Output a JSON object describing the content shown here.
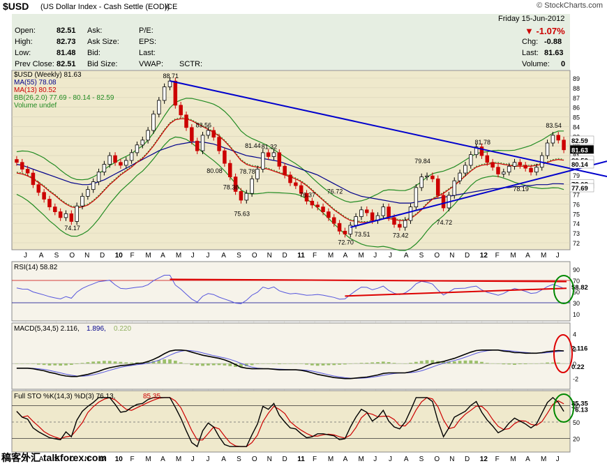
{
  "header": {
    "symbol": "$USD",
    "name": "(US Dollar Index - Cash Settle (EOD))",
    "exchange": "ICE",
    "brand": "© StockCharts.com"
  },
  "quote": {
    "open_label": "Open:",
    "open": "82.51",
    "high_label": "High:",
    "high": "82.73",
    "low_label": "Low:",
    "low": "81.48",
    "prev_label": "Prev Close:",
    "prev": "82.51",
    "ask_label": "Ask:",
    "asksize_label": "Ask Size:",
    "bid_label": "Bid:",
    "bidsize_label": "Bid Size:",
    "pe_label": "P/E:",
    "eps_label": "EPS:",
    "last_label": "Last:",
    "vwap_label": "VWAP:",
    "sctr_label": "SCTR:",
    "date": "Friday  15-Jun-2012",
    "change_pct": "▼ -1.07%",
    "chg_label": "Chg:",
    "chg": "-0.88",
    "last2_label": "Last:",
    "last2": "81.63",
    "volume_label": "Volume:",
    "volume": "0"
  },
  "legend": {
    "main": "$USD (Weekly) 81.63",
    "ma55": "MA(55) 78.08",
    "ma13": "MA(13) 80.52",
    "bb": "BB(26,2.0) 77.69 - 80.14 - 82.59",
    "vol": "Volume undef"
  },
  "panels": {
    "rsi_label": "RSI(14) 58.82",
    "macd_label_a": "MACD(5,34,5) 2.116,",
    "macd_label_b": "1.896,",
    "macd_label_c": "0.220",
    "sto_label_a": "Full STO %K(14,3) %D(3) 76.13,",
    "sto_label_b": "85.35"
  },
  "watermark": "稿客外汇 talkforex.com",
  "colors": {
    "trend": "#0000cc",
    "bb": "#228b22",
    "ma13": "#cc0000",
    "ma55": "#00008b",
    "up": "#000000",
    "down": "#cc0000",
    "panelbg": "#efe9cc",
    "quotebg": "#e6eee2"
  },
  "chart_data": {
    "type": "candlestick",
    "interval": "weekly",
    "ylim": [
      72,
      89
    ],
    "price_ticks": [
      72,
      73,
      74,
      75,
      76,
      77,
      78,
      79,
      80,
      81,
      82,
      83,
      84,
      85,
      86,
      87,
      88,
      89
    ],
    "x_labels": [
      "J",
      "A",
      "S",
      "O",
      "N",
      "D",
      "10",
      "F",
      "M",
      "A",
      "M",
      "J",
      "J",
      "A",
      "S",
      "O",
      "N",
      "D",
      "11",
      "F",
      "M",
      "A",
      "M",
      "J",
      "J",
      "A",
      "S",
      "O",
      "N",
      "D",
      "12",
      "F",
      "M",
      "A",
      "M",
      "J"
    ],
    "annotations": [
      {
        "label": "88.71",
        "value": 88.71
      },
      {
        "label": "83.56",
        "value": 83.56
      },
      {
        "label": "80.08",
        "value": 80.08
      },
      {
        "label": "81.44",
        "value": 81.44
      },
      {
        "label": "81.32",
        "value": 81.32
      },
      {
        "label": "78.36",
        "value": 78.36
      },
      {
        "label": "78.78",
        "value": 78.78
      },
      {
        "label": "75.63",
        "value": 75.63
      },
      {
        "label": "74.17",
        "value": 74.17
      },
      {
        "label": "76.37",
        "value": 76.37
      },
      {
        "label": "76.72",
        "value": 76.72
      },
      {
        "label": "72.70",
        "value": 72.7
      },
      {
        "label": "73.51",
        "value": 73.51
      },
      {
        "label": "73.42",
        "value": 73.42
      },
      {
        "label": "79.84",
        "value": 79.84
      },
      {
        "label": "74.72",
        "value": 74.72
      },
      {
        "label": "81.78",
        "value": 81.78
      },
      {
        "label": "78.19",
        "value": 78.19
      },
      {
        "label": "83.54",
        "value": 83.54
      }
    ],
    "right_labels": [
      {
        "label": "82.59",
        "value": 82.59
      },
      {
        "label": "81.63",
        "value": 81.63
      },
      {
        "label": "80.52",
        "value": 80.52
      },
      {
        "label": "80.14",
        "value": 80.14
      },
      {
        "label": "78.08",
        "value": 78.08
      },
      {
        "label": "77.69",
        "value": 77.69
      }
    ],
    "close_path": [
      80.3,
      79.6,
      79.2,
      78.0,
      77.2,
      76.5,
      75.7,
      75.2,
      74.6,
      75.0,
      74.2,
      75.8,
      76.8,
      77.5,
      78.3,
      79.3,
      80.1,
      81.0,
      80.3,
      80.0,
      80.5,
      81.3,
      82.1,
      82.6,
      83.6,
      85.3,
      86.7,
      88.1,
      88.7,
      86.2,
      85.2,
      83.9,
      82.5,
      81.5,
      83.1,
      83.6,
      82.9,
      81.5,
      80.2,
      78.8,
      77.3,
      76.4,
      77.1,
      78.6,
      79.6,
      81.3,
      80.9,
      81.3,
      79.9,
      79.0,
      78.2,
      77.9,
      77.1,
      76.3,
      75.9,
      75.7,
      75.2,
      74.6,
      74.0,
      73.2,
      72.9,
      73.8,
      74.7,
      75.4,
      75.1,
      74.3,
      74.8,
      75.7,
      74.6,
      73.9,
      73.6,
      74.3,
      75.7,
      77.7,
      78.8,
      78.9,
      78.6,
      76.9,
      75.6,
      76.9,
      78.4,
      79.2,
      80.0,
      81.1,
      81.9,
      81.0,
      80.3,
      79.8,
      79.1,
      79.3,
      79.9,
      80.3,
      80.0,
      79.7,
      79.3,
      79.8,
      81.0,
      82.3,
      83.1,
      82.6,
      81.6
    ],
    "ma13": [
      79.2,
      79.1,
      78.9,
      78.6,
      78.2,
      77.8,
      77.3,
      76.9,
      76.4,
      76.0,
      75.7,
      75.6,
      75.7,
      75.9,
      76.3,
      76.8,
      77.4,
      78.0,
      78.5,
      79.0,
      79.4,
      79.8,
      80.3,
      80.7,
      81.3,
      82.0,
      82.8,
      83.6,
      84.3,
      84.7,
      84.8,
      84.8,
      84.6,
      84.3,
      84.0,
      83.7,
      83.4,
      83.0,
      82.5,
      81.9,
      81.2,
      80.5,
      80.1,
      79.9,
      79.8,
      79.7,
      79.6,
      79.4,
      79.2,
      79.0,
      78.8,
      78.6,
      78.3,
      77.9,
      77.4,
      76.9,
      76.4,
      75.9,
      75.4,
      75.0,
      74.6,
      74.3,
      74.2,
      74.1,
      74.1,
      74.2,
      74.3,
      74.5,
      74.5,
      74.4,
      74.3,
      74.3,
      74.5,
      74.9,
      75.4,
      76.0,
      76.5,
      76.8,
      77.1,
      77.5,
      77.9,
      78.4,
      78.9,
      79.4,
      79.8,
      80.0,
      80.1,
      80.2,
      80.2,
      80.1,
      80.0,
      79.9,
      79.9,
      79.9,
      79.9,
      80.0,
      80.1,
      80.3,
      80.5,
      80.6,
      80.52
    ],
    "ma55": [
      80.1,
      80.0,
      79.8,
      79.6,
      79.4,
      79.2,
      79.0,
      78.8,
      78.6,
      78.4,
      78.2,
      78.1,
      78.0,
      78.0,
      78.1,
      78.3,
      78.5,
      78.8,
      79.1,
      79.4,
      79.7,
      80.0,
      80.3,
      80.6,
      80.9,
      81.2,
      81.5,
      81.7,
      81.9,
      82.1,
      82.2,
      82.3,
      82.4,
      82.4,
      82.4,
      82.3,
      82.2,
      82.0,
      81.8,
      81.6,
      81.4,
      81.2,
      81.0,
      80.9,
      80.8,
      80.7,
      80.6,
      80.5,
      80.4,
      80.2,
      80.0,
      79.8,
      79.6,
      79.4,
      79.2,
      79.0,
      78.7,
      78.4,
      78.1,
      77.8,
      77.5,
      77.2,
      77.0,
      76.8,
      76.7,
      76.6,
      76.5,
      76.4,
      76.3,
      76.2,
      76.1,
      76.1,
      76.1,
      76.2,
      76.3,
      76.4,
      76.5,
      76.6,
      76.7,
      76.8,
      76.9,
      77.0,
      77.1,
      77.2,
      77.3,
      77.4,
      77.5,
      77.6,
      77.6,
      77.7,
      77.7,
      77.8,
      77.8,
      77.9,
      77.9,
      78.0,
      78.0,
      78.0,
      78.1,
      78.1,
      78.08
    ],
    "trendlines": [
      {
        "from": [
          28,
          88.71
        ],
        "to": [
          105,
          79.2
        ]
      },
      {
        "from": [
          61,
          73.6
        ],
        "to": [
          105,
          80.0
        ]
      }
    ],
    "rsi": {
      "value": 58.82,
      "ticks": [
        10,
        30,
        50,
        70,
        90
      ]
    },
    "macd": {
      "macd": 2.116,
      "signal": 1.896,
      "hist": 0.22,
      "ticks": [
        -2,
        0,
        2,
        4
      ]
    },
    "stochastic": {
      "k": 76.13,
      "d": 85.35,
      "ticks": [
        20,
        50,
        80
      ]
    }
  }
}
